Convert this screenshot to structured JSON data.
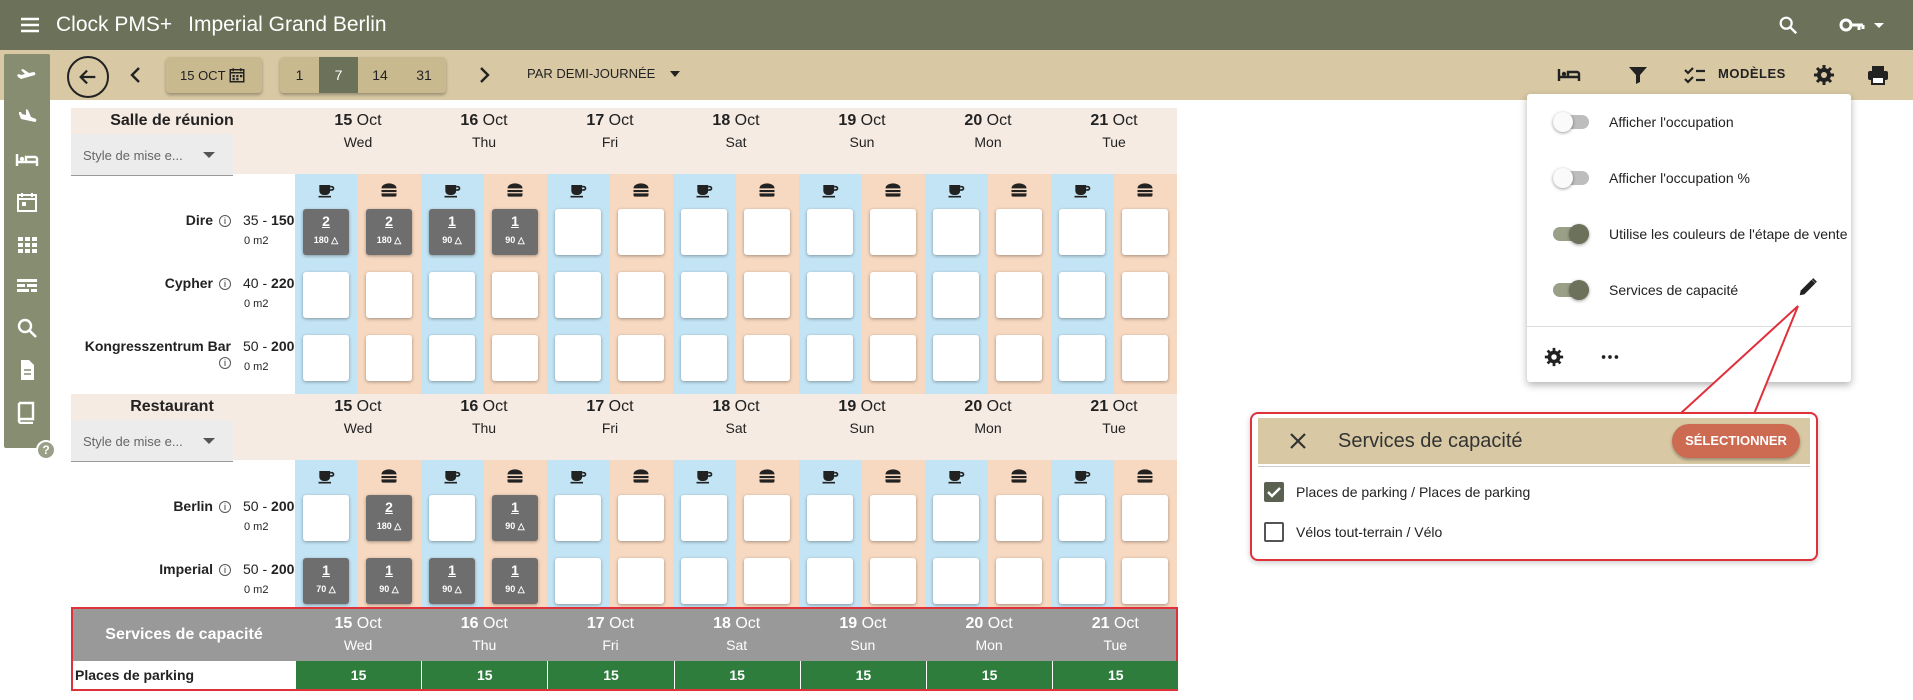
{
  "app": {
    "name": "Clock PMS+",
    "hotel": "Imperial Grand Berlin"
  },
  "toolbar": {
    "date": "15 OCT",
    "ranges": [
      "1",
      "7",
      "14",
      "31"
    ],
    "mode": "PAR DEMI-JOURNÉE",
    "models_label": "MODÈLES"
  },
  "days": [
    {
      "num": "15",
      "mon": "Oct",
      "dow": "Wed"
    },
    {
      "num": "16",
      "mon": "Oct",
      "dow": "Thu"
    },
    {
      "num": "17",
      "mon": "Oct",
      "dow": "Fri"
    },
    {
      "num": "18",
      "mon": "Oct",
      "dow": "Sat"
    },
    {
      "num": "19",
      "mon": "Oct",
      "dow": "Sun"
    },
    {
      "num": "20",
      "mon": "Oct",
      "dow": "Mon"
    },
    {
      "num": "21",
      "mon": "Oct",
      "dow": "Tue"
    }
  ],
  "sections": [
    {
      "title": "Salle de réunion",
      "style_placeholder": "Style de mise e...",
      "rooms": [
        {
          "name": "Dire",
          "min": "35",
          "max": "150",
          "area": "0 m2",
          "slots": [
            {
              "n": "2",
              "s": "180"
            },
            {
              "n": "2",
              "s": "180"
            },
            {
              "n": "1",
              "s": "90"
            },
            {
              "n": "1",
              "s": "90"
            },
            null,
            null,
            null,
            null,
            null,
            null,
            null,
            null,
            null,
            null
          ]
        },
        {
          "name": "Cypher",
          "min": "40",
          "max": "220",
          "area": "0 m2",
          "slots": [
            null,
            null,
            null,
            null,
            null,
            null,
            null,
            null,
            null,
            null,
            null,
            null,
            null,
            null
          ]
        },
        {
          "name": "Kongresszentrum Bar",
          "min": "50",
          "max": "200",
          "area": "0 m2",
          "slots": [
            null,
            null,
            null,
            null,
            null,
            null,
            null,
            null,
            null,
            null,
            null,
            null,
            null,
            null
          ]
        }
      ]
    },
    {
      "title": "Restaurant",
      "style_placeholder": "Style de mise e...",
      "rooms": [
        {
          "name": "Berlin",
          "min": "50",
          "max": "200",
          "area": "0 m2",
          "slots": [
            null,
            {
              "n": "2",
              "s": "180"
            },
            null,
            {
              "n": "1",
              "s": "90"
            },
            null,
            null,
            null,
            null,
            null,
            null,
            null,
            null,
            null,
            null
          ]
        },
        {
          "name": "Imperial",
          "min": "50",
          "max": "200",
          "area": "0 m2",
          "slots": [
            {
              "n": "1",
              "s": "70"
            },
            {
              "n": "1",
              "s": "90"
            },
            {
              "n": "1",
              "s": "90"
            },
            {
              "n": "1",
              "s": "90"
            },
            null,
            null,
            null,
            null,
            null,
            null,
            null,
            null,
            null,
            null
          ]
        }
      ]
    }
  ],
  "capacity_services": {
    "title": "Services de capacité",
    "rows": [
      {
        "label": "Places de parking",
        "values": [
          "15",
          "15",
          "15",
          "15",
          "15",
          "15",
          "15"
        ]
      }
    ]
  },
  "dropdown": {
    "items": [
      {
        "label": "Afficher l'occupation",
        "on": false
      },
      {
        "label": "Afficher l'occupation %",
        "on": false
      },
      {
        "label": "Utilise les couleurs de l'étape de vente",
        "on": true
      },
      {
        "label": "Services de capacité",
        "on": true
      }
    ]
  },
  "callout": {
    "title": "Services de capacité",
    "select_label": "SÉLECTIONNER",
    "options": [
      {
        "label": "Places de parking / Places de parking",
        "checked": true
      },
      {
        "label": "Vélos tout-terrain / Vélo",
        "checked": false
      }
    ]
  },
  "colors": {
    "topbar": "#6b7259",
    "toolbar": "#d8c9a4",
    "am": "#c3e4f4",
    "pm": "#f7d8c0",
    "capacity": "#2e7d3d",
    "highlight": "#e0303a"
  }
}
